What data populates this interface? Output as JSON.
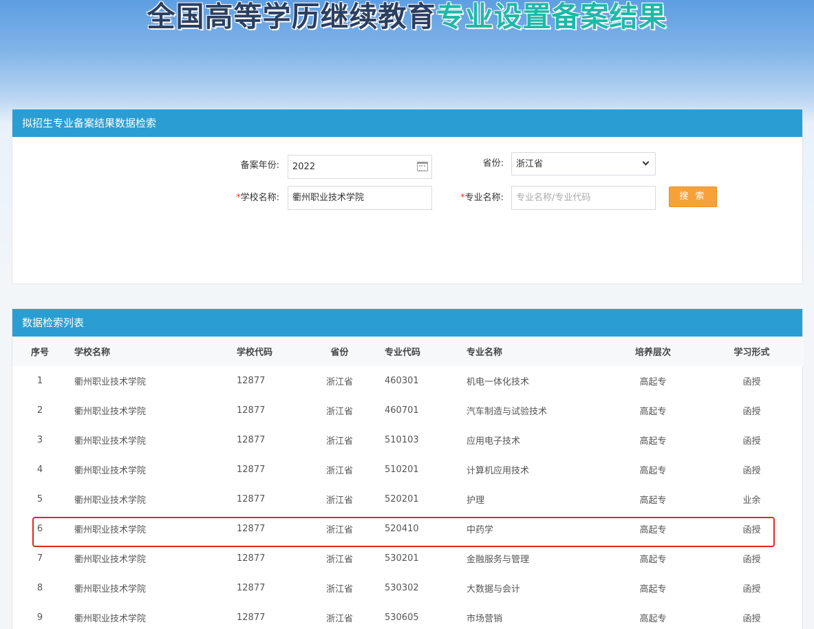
{
  "banner": {
    "title_part1": "全国高等学历继续教育",
    "title_part2": "专业设置备案结果"
  },
  "search": {
    "panel_title": "拟招生专业备案结果数据检索",
    "year_label": "备案年份:",
    "year_value": "2022",
    "province_label": "省份:",
    "province_value": "浙江省",
    "required_mark": "*",
    "school_label": "学校名称:",
    "school_value": "衢州职业技术学院",
    "major_label": "专业名称:",
    "major_placeholder": "专业名称/专业代码",
    "search_button": "搜 索"
  },
  "list": {
    "panel_title": "数据检索列表",
    "columns": [
      "序号",
      "学校名称",
      "学校代码",
      "省份",
      "专业代码",
      "专业名称",
      "培养层次",
      "学习形式"
    ],
    "rows": [
      [
        "1",
        "衢州职业技术学院",
        "12877",
        "浙江省",
        "460301",
        "机电一体化技术",
        "高起专",
        "函授"
      ],
      [
        "2",
        "衢州职业技术学院",
        "12877",
        "浙江省",
        "460701",
        "汽车制造与试验技术",
        "高起专",
        "函授"
      ],
      [
        "3",
        "衢州职业技术学院",
        "12877",
        "浙江省",
        "510103",
        "应用电子技术",
        "高起专",
        "函授"
      ],
      [
        "4",
        "衢州职业技术学院",
        "12877",
        "浙江省",
        "510201",
        "计算机应用技术",
        "高起专",
        "函授"
      ],
      [
        "5",
        "衢州职业技术学院",
        "12877",
        "浙江省",
        "520201",
        "护理",
        "高起专",
        "业余"
      ],
      [
        "6",
        "衢州职业技术学院",
        "12877",
        "浙江省",
        "520410",
        "中药学",
        "高起专",
        "函授"
      ],
      [
        "7",
        "衢州职业技术学院",
        "12877",
        "浙江省",
        "530201",
        "金融服务与管理",
        "高起专",
        "函授"
      ],
      [
        "8",
        "衢州职业技术学院",
        "12877",
        "浙江省",
        "530302",
        "大数据与会计",
        "高起专",
        "函授"
      ],
      [
        "9",
        "衢州职业技术学院",
        "12877",
        "浙江省",
        "530605",
        "市场营销",
        "高起专",
        "函授"
      ]
    ],
    "highlighted_row": 6
  },
  "colors": {
    "header_blue": "#2a9ed2",
    "search_orange": "#f7a13a",
    "highlight_red": "#e1261c"
  }
}
